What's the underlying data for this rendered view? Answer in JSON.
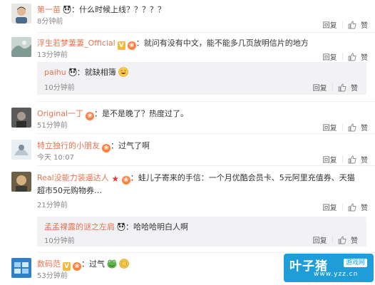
{
  "actions": {
    "reply": "回复",
    "like": "赞"
  },
  "comments": [
    {
      "user": "第一苗",
      "text": "什么时候上线？？？？？",
      "time": "8分钟前",
      "badges": [
        "panda"
      ]
    },
    {
      "user": "浮生若梦萋萋_Official",
      "text": "就问有没有中文，能不能多几页放明信片的地方",
      "time": "13分钟前",
      "badges": [
        "v",
        "medal"
      ]
    },
    {
      "user": "paihu",
      "text": "就缺相簿",
      "time": "10分钟前",
      "badges": [
        "panda"
      ],
      "emoji": "laugh"
    },
    {
      "user": "Original一丁",
      "text": "是不是晚了？热度过了。",
      "time": "51分钟前",
      "badges": [
        "medal"
      ]
    },
    {
      "user": "特立独行的小朋友",
      "text": "过气了啊",
      "time": "今天 10:07",
      "badges": [
        "medal"
      ]
    },
    {
      "user": "Real没能力装逼达人",
      "text": "蛙儿子寄来的手信：一个月优酷会员卡、5元阿里充值券、天猫超市50元购物券…",
      "time": "21分钟前",
      "badges": [
        "star",
        "medal"
      ]
    },
    {
      "user": "孟孟裸露的谜之左肩",
      "text": "哈哈哈明白人啊",
      "time": "10分钟前",
      "badges": [
        "panda"
      ]
    },
    {
      "user": "数码范",
      "text": "过气",
      "time": "53分钟前",
      "badges": [
        "v",
        "medal"
      ],
      "emoji": "frog"
    }
  ],
  "watermark": {
    "title": "叶子猪",
    "tag": "游戏网",
    "url": "www.yzz.cn"
  }
}
